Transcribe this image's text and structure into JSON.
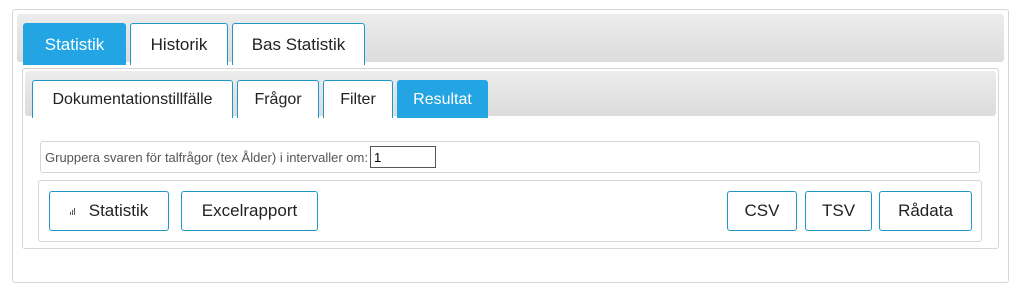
{
  "main_tabs": [
    {
      "label": "Statistik",
      "active": true
    },
    {
      "label": "Historik",
      "active": false
    },
    {
      "label": "Bas Statistik",
      "active": false
    }
  ],
  "sub_tabs": [
    {
      "label": "Dokumentationstillfälle",
      "active": false
    },
    {
      "label": "Frågor",
      "active": false
    },
    {
      "label": "Filter",
      "active": false
    },
    {
      "label": "Resultat",
      "active": true
    }
  ],
  "grouping": {
    "label": "Gruppera svaren för talfrågor (tex Ålder) i intervaller om:",
    "value": "1"
  },
  "buttons": {
    "statistik": "Statistik",
    "excelrapport": "Excelrapport",
    "csv": "CSV",
    "tsv": "TSV",
    "radata": "Rådata"
  },
  "icons": {
    "statistik_button_icon": "bar-chart-icon"
  },
  "colors": {
    "accent": "#24a5e3",
    "border": "#1f97c8"
  }
}
